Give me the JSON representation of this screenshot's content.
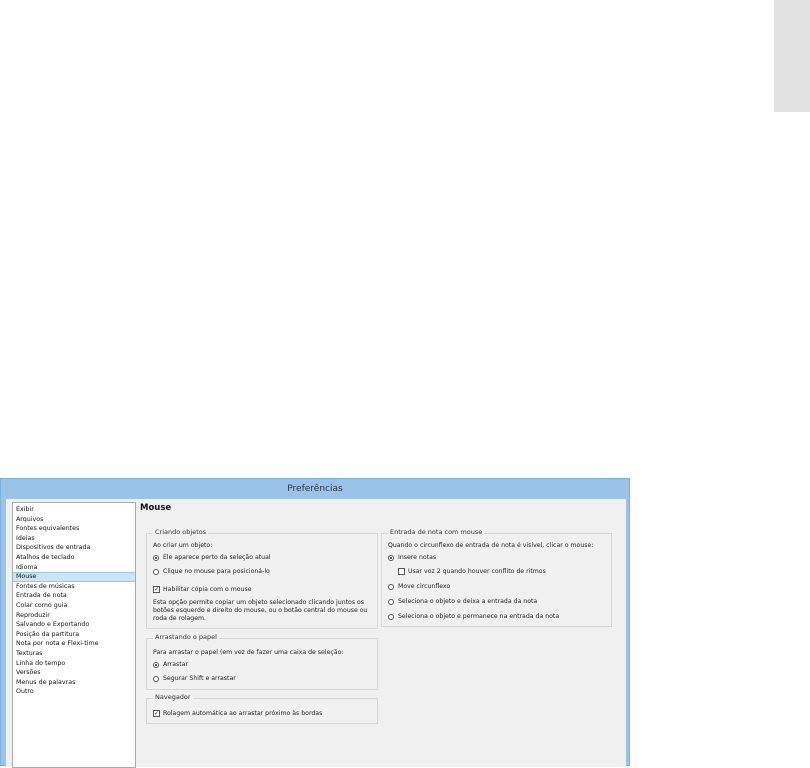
{
  "window": {
    "title": "Preferências"
  },
  "nav": {
    "items": [
      {
        "label": "Exibir"
      },
      {
        "label": "Arquivos"
      },
      {
        "label": "Fontes equivalentes"
      },
      {
        "label": "Ideias"
      },
      {
        "label": "Dispositivos de entrada"
      },
      {
        "label": "Atalhos de teclado"
      },
      {
        "label": "Idioma"
      },
      {
        "label": "Mouse",
        "selected": true
      },
      {
        "label": "Fontes de músicas"
      },
      {
        "label": "Entrada de nota"
      },
      {
        "label": "Colar como guia"
      },
      {
        "label": "Reproduzir"
      },
      {
        "label": "Salvando e Exportando"
      },
      {
        "label": "Posição da partitura"
      },
      {
        "label": "Nota por nota e Flexi-time"
      },
      {
        "label": "Texturas"
      },
      {
        "label": "Linha do tempo"
      },
      {
        "label": "Versões"
      },
      {
        "label": "Menus de palavras"
      },
      {
        "label": "Outro"
      }
    ]
  },
  "page": {
    "heading": "Mouse"
  },
  "creating": {
    "title": "Criando objetos",
    "prompt": "Ao criar um objeto:",
    "option1": "Ele aparece perto da seleção atual",
    "option2": "Clique no mouse para posicioná-lo",
    "copy_label": "Habilitar cópia com o mouse",
    "description": "Esta opção permite copiar um objeto selecionado clicando juntos os botões esquerdo e direito do mouse, ou o botão central do mouse ou roda de rolagem."
  },
  "dragging": {
    "title": "Arrastando o papel",
    "prompt": "Para arrastar o papel (em vez de fazer uma caixa de seleção:",
    "option1": "Arrastar",
    "option2": "Segurar Shift e arrastar"
  },
  "navigator": {
    "title": "Navegador",
    "autoscroll_label": "Rolagem automática ao arrastar próximo às bordas"
  },
  "note_entry": {
    "title": "Entrada de nota com mouse",
    "prompt": "Quando o circunflexo de entrada de nota é visível, clicar o mouse:",
    "option1": "Insere notas",
    "voice2_label": "Usar voz 2 quando houver conflito de ritmos",
    "option2": "Move circunflexo",
    "option3": "Seleciona o objeto e deixa a entrada da nota",
    "option4": "Seleciona o objeto e permanece na entrada da nota"
  },
  "icons": {
    "check": "✓"
  }
}
